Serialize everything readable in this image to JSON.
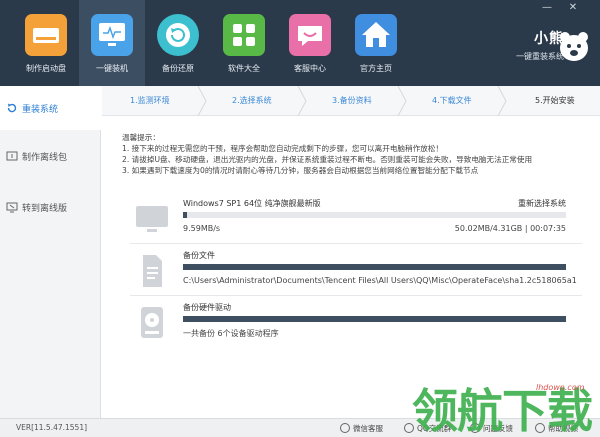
{
  "window_controls": {
    "minimize": "—",
    "close": "✕"
  },
  "nav": [
    {
      "label": "制作启动盘",
      "icon": "drive-icon",
      "color": "#f5a13a"
    },
    {
      "label": "一键装机",
      "icon": "monitor-icon",
      "color": "#4aa3e8"
    },
    {
      "label": "备份还原",
      "icon": "restore-icon",
      "color": "#3cc0d0"
    },
    {
      "label": "软件大全",
      "icon": "apps-grid-icon",
      "color": "#58b947"
    },
    {
      "label": "客服中心",
      "icon": "chat-icon",
      "color": "#e96fa8"
    },
    {
      "label": "官方主页",
      "icon": "home-icon",
      "color": "#3f8ee0"
    }
  ],
  "brand": {
    "name": "小熊",
    "slogan": "一键重装系统"
  },
  "sidebar": {
    "items": [
      {
        "label": "重装系统",
        "icon": "refresh-icon"
      },
      {
        "label": "制作离线包",
        "icon": "package-icon"
      },
      {
        "label": "转到离线版",
        "icon": "offline-monitor-icon"
      }
    ]
  },
  "steps": [
    {
      "label": "1.监测环境"
    },
    {
      "label": "2.选择系统"
    },
    {
      "label": "3.备份资料"
    },
    {
      "label": "4.下载文件"
    },
    {
      "label": "5.开始安装"
    }
  ],
  "notice": {
    "title": "温馨提示：",
    "lines": [
      "1. 接下来的过程无需您的干预，程序会帮助您自动完成剩下的步骤，您可以离开电脑稍作放松！",
      "2. 请拔掉U盘、移动硬盘，退出光驱内的光盘，并保证系统重装过程不断电。否则重装可能会失败，导致电脑无法正常使用",
      "3. 如果遇到下载速度为0的情况时请耐心等待几分钟，服务器会自动根据您当前网络位置智能分配下载节点"
    ]
  },
  "tasks": [
    {
      "name": "Windows7 SP1 64位 纯净旗舰最新版",
      "action": "重新选择系统",
      "progress": 0.01,
      "speed": "9.59MB/s",
      "stats": "50.02MB/4.31GB | 00:07:35",
      "icon": "monitor-icon"
    },
    {
      "name": "备份文件",
      "progress": 1.0,
      "path": "C:\\Users\\Administrator\\Documents\\Tencent Files\\All Users\\QQ\\Misc\\OperateFace\\sha1.2c518065a1",
      "icon": "document-icon"
    },
    {
      "name": "备份硬件驱动",
      "progress": 1.0,
      "info": "一共备份 6个设备驱动程序",
      "icon": "hard-disk-icon"
    }
  ],
  "statusbar": {
    "version": "VER[11.5.47.1551]",
    "items": [
      {
        "label": "微信客服",
        "icon": "wechat-icon"
      },
      {
        "label": "QQ交流群",
        "icon": "qq-icon"
      },
      {
        "label": "问题反馈",
        "icon": "feedback-icon"
      },
      {
        "label": "帮助视频",
        "icon": "help-icon"
      }
    ]
  },
  "watermark": {
    "url": "lhdown.com",
    "text": "领航下载"
  }
}
